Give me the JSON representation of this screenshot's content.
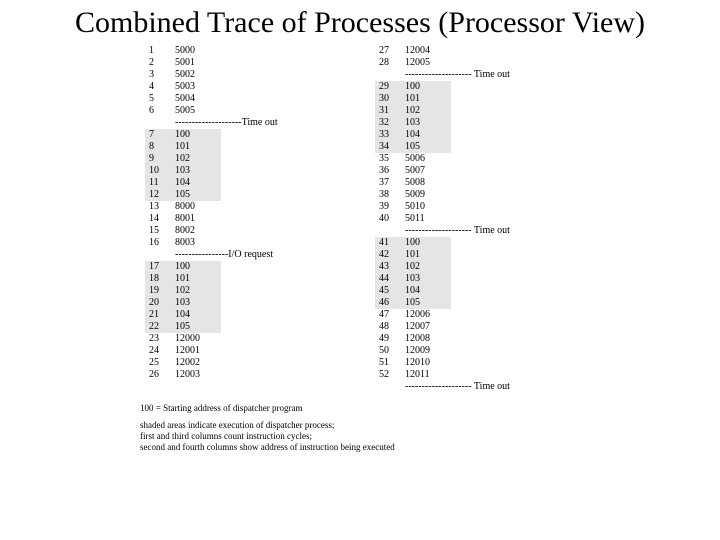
{
  "title": "Combined Trace of Processes (Processor View)",
  "separator_timeout_label": "Time out",
  "separator_io_label": "I/O request",
  "left": [
    {
      "type": "row",
      "cycle": "1",
      "addr": "5000",
      "shaded": false
    },
    {
      "type": "row",
      "cycle": "2",
      "addr": "5001",
      "shaded": false
    },
    {
      "type": "row",
      "cycle": "3",
      "addr": "5002",
      "shaded": false
    },
    {
      "type": "row",
      "cycle": "4",
      "addr": "5003",
      "shaded": false
    },
    {
      "type": "row",
      "cycle": "5",
      "addr": "5004",
      "shaded": false
    },
    {
      "type": "row",
      "cycle": "6",
      "addr": "5005",
      "shaded": false
    },
    {
      "type": "sep",
      "label": "--------------------Time out"
    },
    {
      "type": "row",
      "cycle": "7",
      "addr": "100",
      "shaded": true
    },
    {
      "type": "row",
      "cycle": "8",
      "addr": "101",
      "shaded": true
    },
    {
      "type": "row",
      "cycle": "9",
      "addr": "102",
      "shaded": true
    },
    {
      "type": "row",
      "cycle": "10",
      "addr": "103",
      "shaded": true
    },
    {
      "type": "row",
      "cycle": "11",
      "addr": "104",
      "shaded": true
    },
    {
      "type": "row",
      "cycle": "12",
      "addr": "105",
      "shaded": true
    },
    {
      "type": "row",
      "cycle": "13",
      "addr": "8000",
      "shaded": false
    },
    {
      "type": "row",
      "cycle": "14",
      "addr": "8001",
      "shaded": false
    },
    {
      "type": "row",
      "cycle": "15",
      "addr": "8002",
      "shaded": false
    },
    {
      "type": "row",
      "cycle": "16",
      "addr": "8003",
      "shaded": false
    },
    {
      "type": "sep",
      "label": "----------------I/O request"
    },
    {
      "type": "row",
      "cycle": "17",
      "addr": "100",
      "shaded": true
    },
    {
      "type": "row",
      "cycle": "18",
      "addr": "101",
      "shaded": true
    },
    {
      "type": "row",
      "cycle": "19",
      "addr": "102",
      "shaded": true
    },
    {
      "type": "row",
      "cycle": "20",
      "addr": "103",
      "shaded": true
    },
    {
      "type": "row",
      "cycle": "21",
      "addr": "104",
      "shaded": true
    },
    {
      "type": "row",
      "cycle": "22",
      "addr": "105",
      "shaded": true
    },
    {
      "type": "row",
      "cycle": "23",
      "addr": "12000",
      "shaded": false
    },
    {
      "type": "row",
      "cycle": "24",
      "addr": "12001",
      "shaded": false
    },
    {
      "type": "row",
      "cycle": "25",
      "addr": "12002",
      "shaded": false
    },
    {
      "type": "row",
      "cycle": "26",
      "addr": "12003",
      "shaded": false
    }
  ],
  "right": [
    {
      "type": "row",
      "cycle": "27",
      "addr": "12004",
      "shaded": false
    },
    {
      "type": "row",
      "cycle": "28",
      "addr": "12005",
      "shaded": false
    },
    {
      "type": "sep",
      "label": "-------------------- Time out"
    },
    {
      "type": "row",
      "cycle": "29",
      "addr": "100",
      "shaded": true
    },
    {
      "type": "row",
      "cycle": "30",
      "addr": "101",
      "shaded": true
    },
    {
      "type": "row",
      "cycle": "31",
      "addr": "102",
      "shaded": true
    },
    {
      "type": "row",
      "cycle": "32",
      "addr": "103",
      "shaded": true
    },
    {
      "type": "row",
      "cycle": "33",
      "addr": "104",
      "shaded": true
    },
    {
      "type": "row",
      "cycle": "34",
      "addr": "105",
      "shaded": true
    },
    {
      "type": "row",
      "cycle": "35",
      "addr": "5006",
      "shaded": false
    },
    {
      "type": "row",
      "cycle": "36",
      "addr": "5007",
      "shaded": false
    },
    {
      "type": "row",
      "cycle": "37",
      "addr": "5008",
      "shaded": false
    },
    {
      "type": "row",
      "cycle": "38",
      "addr": "5009",
      "shaded": false
    },
    {
      "type": "row",
      "cycle": "39",
      "addr": "5010",
      "shaded": false
    },
    {
      "type": "row",
      "cycle": "40",
      "addr": "5011",
      "shaded": false
    },
    {
      "type": "sep",
      "label": "-------------------- Time out"
    },
    {
      "type": "row",
      "cycle": "41",
      "addr": "100",
      "shaded": true
    },
    {
      "type": "row",
      "cycle": "42",
      "addr": "101",
      "shaded": true
    },
    {
      "type": "row",
      "cycle": "43",
      "addr": "102",
      "shaded": true
    },
    {
      "type": "row",
      "cycle": "44",
      "addr": "103",
      "shaded": true
    },
    {
      "type": "row",
      "cycle": "45",
      "addr": "104",
      "shaded": true
    },
    {
      "type": "row",
      "cycle": "46",
      "addr": "105",
      "shaded": true
    },
    {
      "type": "row",
      "cycle": "47",
      "addr": "12006",
      "shaded": false
    },
    {
      "type": "row",
      "cycle": "48",
      "addr": "12007",
      "shaded": false
    },
    {
      "type": "row",
      "cycle": "49",
      "addr": "12008",
      "shaded": false
    },
    {
      "type": "row",
      "cycle": "50",
      "addr": "12009",
      "shaded": false
    },
    {
      "type": "row",
      "cycle": "51",
      "addr": "12010",
      "shaded": false
    },
    {
      "type": "row",
      "cycle": "52",
      "addr": "12011",
      "shaded": false
    },
    {
      "type": "sep",
      "label": "-------------------- Time out"
    }
  ],
  "footnotes": {
    "line1": "100 = Starting address of dispatcher program",
    "line2": "shaded areas indicate execution of dispatcher process;",
    "line3": "first and third columns count instruction cycles;",
    "line4": "second and fourth columns show address of instruction being executed"
  }
}
